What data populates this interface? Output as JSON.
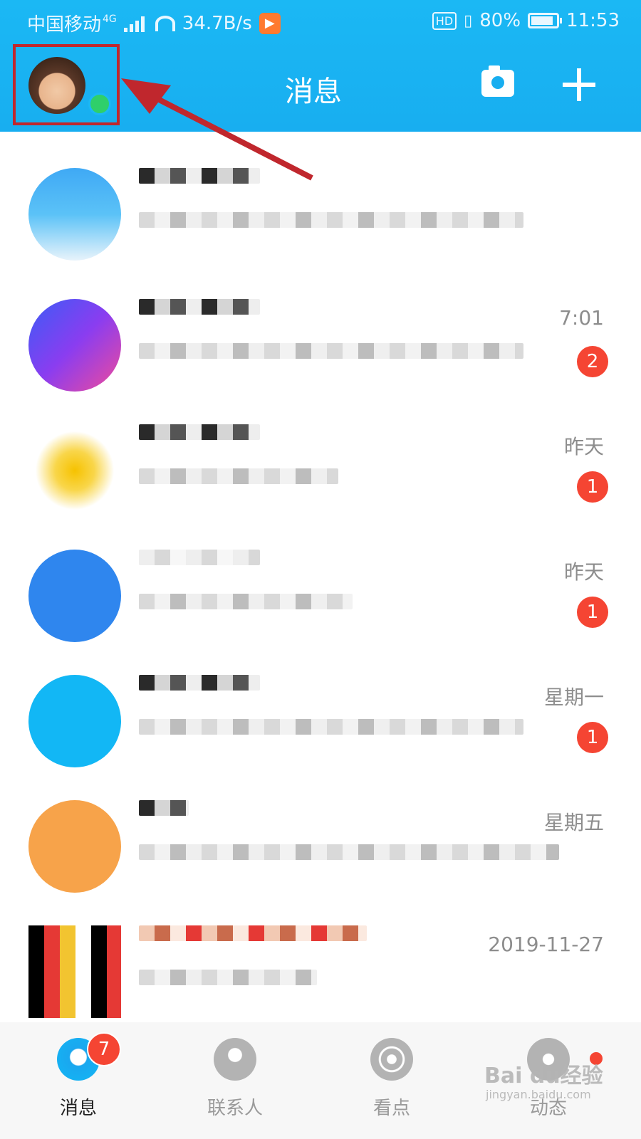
{
  "statusbar": {
    "carrier": "中国移动",
    "network": "4G",
    "speed": "34.7B/s",
    "hd": "HD",
    "battery": "80%",
    "time": "11:53"
  },
  "header": {
    "title": "消息",
    "camera_icon": "camera-icon",
    "add_icon": "plus-icon",
    "colors": {
      "bg": "#1bb8f4",
      "highlight": "#c0272d",
      "online": "#2fcf6a"
    }
  },
  "chats": [
    {
      "time": "",
      "badge": ""
    },
    {
      "time": "7:01",
      "badge": "2"
    },
    {
      "time": "昨天",
      "badge": "1"
    },
    {
      "time": "昨天",
      "badge": "1"
    },
    {
      "time": "星期一",
      "badge": "1"
    },
    {
      "time": "星期五",
      "badge": ""
    },
    {
      "time": "2019-11-27",
      "badge": ""
    }
  ],
  "tabs": [
    {
      "label": "消息",
      "icon": "qq-penguin-icon",
      "badge": "7"
    },
    {
      "label": "联系人",
      "icon": "contact-icon"
    },
    {
      "label": "看点",
      "icon": "eye-icon"
    },
    {
      "label": "动态",
      "icon": "star-planet-icon"
    }
  ],
  "watermark": {
    "text": "Bai du经验",
    "sub": "jingyan.baidu.com"
  }
}
